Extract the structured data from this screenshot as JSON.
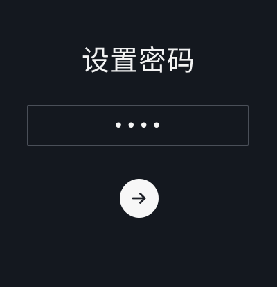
{
  "screen": {
    "title": "设置密码",
    "password": {
      "masked_value": "••••"
    },
    "submit": {
      "icon": "arrow-right-icon"
    }
  },
  "colors": {
    "background": "#14181f",
    "text": "#f2f2f2",
    "input_border": "#4a4f58",
    "button_bg": "#f7f7f7",
    "button_icon": "#1d2027"
  }
}
